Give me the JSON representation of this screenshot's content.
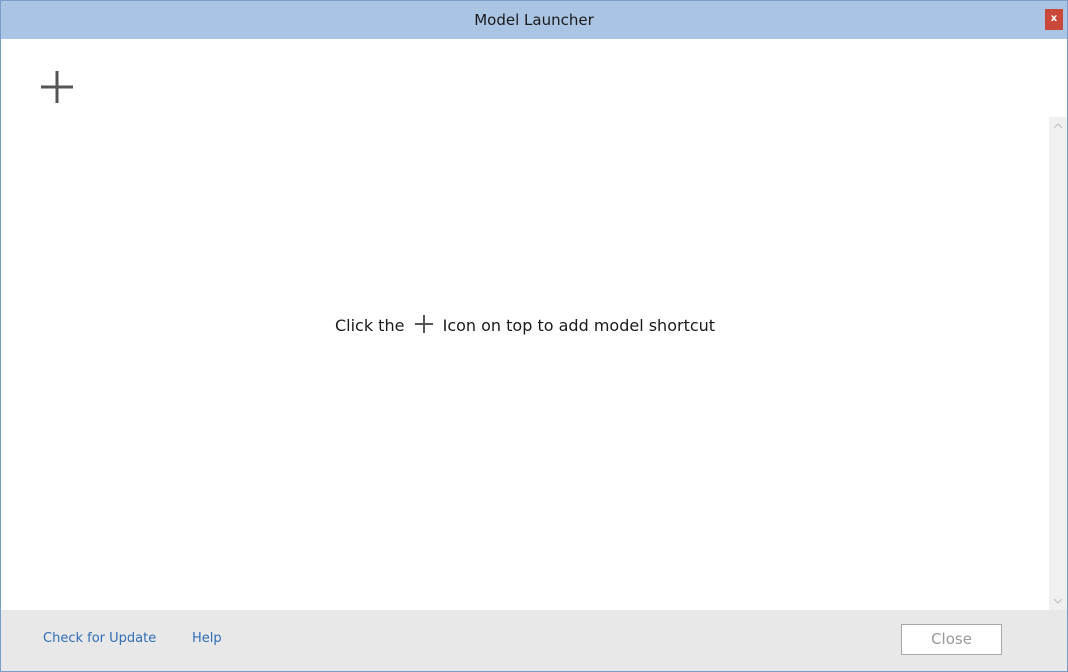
{
  "window": {
    "title": "Model Launcher",
    "close_glyph": "x",
    "titlebar_color": "#aac4e4",
    "close_color": "#c9483a"
  },
  "toolbar": {
    "add_icon": "plus-icon"
  },
  "main": {
    "empty_message_prefix": "Click the",
    "empty_message_icon": "plus-icon",
    "empty_message_suffix": "Icon on top to add model shortcut"
  },
  "scrollbar": {
    "up_glyph": "^",
    "down_glyph": "v"
  },
  "footer": {
    "check_update_label": "Check for Update",
    "help_label": "Help",
    "close_label": "Close",
    "link_color": "#2f6db5"
  }
}
